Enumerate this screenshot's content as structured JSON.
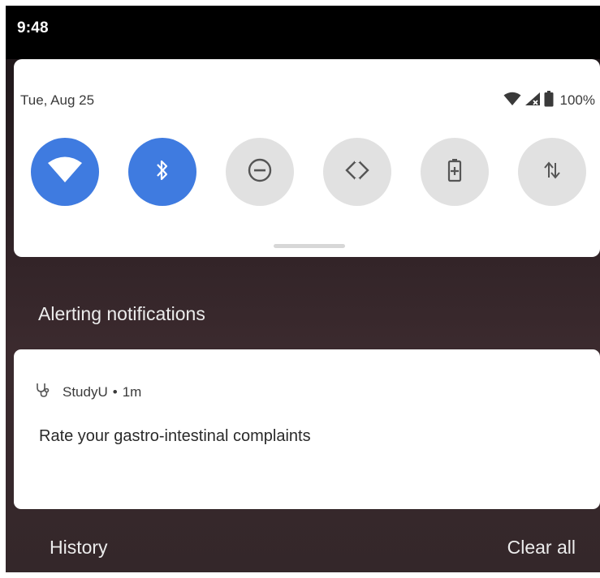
{
  "status_bar": {
    "time": "9:48"
  },
  "quick_settings": {
    "date": "Tue, Aug 25",
    "battery_text": "100%",
    "tiles": [
      {
        "name": "wifi",
        "icon": "wifi-icon",
        "state": "on"
      },
      {
        "name": "bluetooth",
        "icon": "bluetooth-icon",
        "state": "on"
      },
      {
        "name": "do-not-disturb",
        "icon": "do-not-disturb-icon",
        "state": "off"
      },
      {
        "name": "auto-rotate",
        "icon": "auto-rotate-icon",
        "state": "off"
      },
      {
        "name": "battery-saver",
        "icon": "battery-saver-icon",
        "state": "off"
      },
      {
        "name": "mobile-data",
        "icon": "mobile-data-icon",
        "state": "off"
      }
    ]
  },
  "notifications": {
    "section_header": "Alerting notifications",
    "items": [
      {
        "app_icon": "stethoscope-icon",
        "app_name": "StudyU",
        "separator": "•",
        "time": "1m",
        "message": "Rate your gastro-intestinal complaints"
      }
    ]
  },
  "footer": {
    "history_label": "History",
    "clear_all_label": "Clear all"
  },
  "colors": {
    "tile_on": "#3f7be0",
    "tile_off": "#e1e1e1",
    "panel": "#ffffff",
    "status_bar": "#000000"
  }
}
